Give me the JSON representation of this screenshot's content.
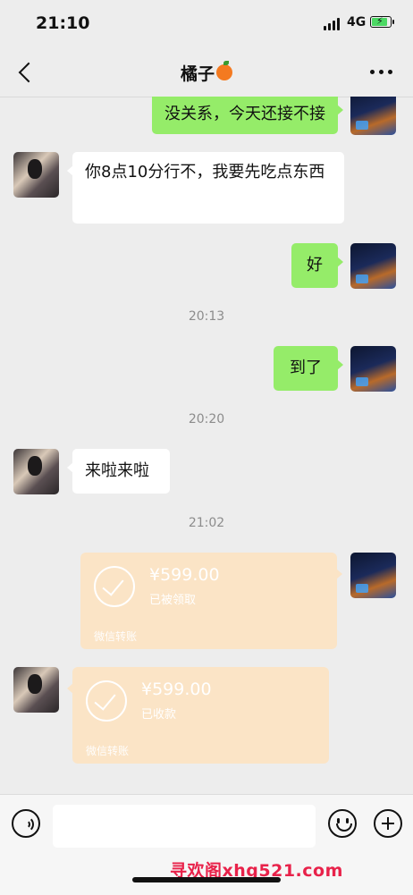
{
  "status_bar": {
    "time": "21:10",
    "network": "4G"
  },
  "header": {
    "title": "橘子"
  },
  "messages": {
    "m1": {
      "sender": "self",
      "text": "没关系，今天还接不接"
    },
    "m2": {
      "sender": "other",
      "text": "你8点10分行不，我要先吃点东西"
    },
    "m3": {
      "sender": "self",
      "text": "好"
    },
    "ts1": "20:13",
    "m4": {
      "sender": "self",
      "text": "到了"
    },
    "ts2": "20:20",
    "m5": {
      "sender": "other",
      "text": "来啦来啦"
    },
    "ts3": "21:02",
    "t1": {
      "sender": "self",
      "amount": "¥599.00",
      "status": "已被领取",
      "footer": "微信转账"
    },
    "t2": {
      "sender": "other",
      "amount": "¥599.00",
      "status": "已收款",
      "footer": "微信转账"
    }
  },
  "input_bar": {
    "placeholder": ""
  },
  "watermark": "寻欢阁xhg521.com",
  "colors": {
    "self_bubble": "#95ec69",
    "other_bubble": "#ffffff",
    "transfer_card": "#fbe4c6",
    "background": "#ededed"
  }
}
